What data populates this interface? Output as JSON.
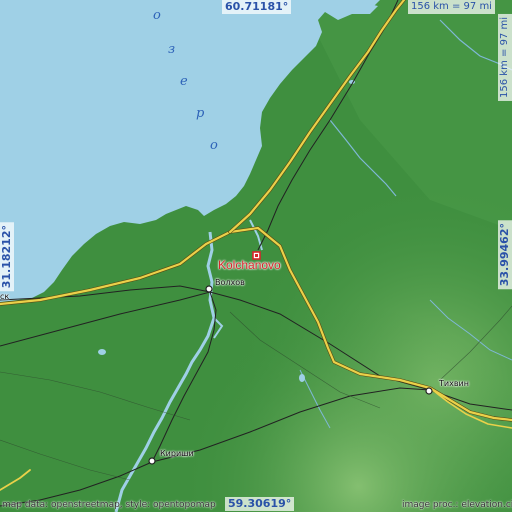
{
  "map": {
    "lake_letters": [
      "о",
      "з",
      "е",
      "р",
      "о"
    ],
    "focus_place": "Kolchanovo",
    "towns": {
      "volkhov": "Волхов",
      "tikhvin": "Тихвин",
      "kirishi": "Кириши",
      "edge_left": "ск"
    },
    "colors": {
      "water": "#9fd0e6",
      "land": "#3f8f3f",
      "road": "#ead14a",
      "rail": "#222222",
      "marker": "#d7262b"
    }
  },
  "coords": {
    "top_lat": "60.71181°",
    "bottom_lat": "59.30619°",
    "left_lon": "31.18212°",
    "right_lon": "33.99462°",
    "scale_top": "156 km = 97 mi",
    "scale_right": "156 km = 97 mi"
  },
  "credits": {
    "left": "map data: openstreetmap, style: opentopomap",
    "right": "image proc.: elevation.city"
  }
}
